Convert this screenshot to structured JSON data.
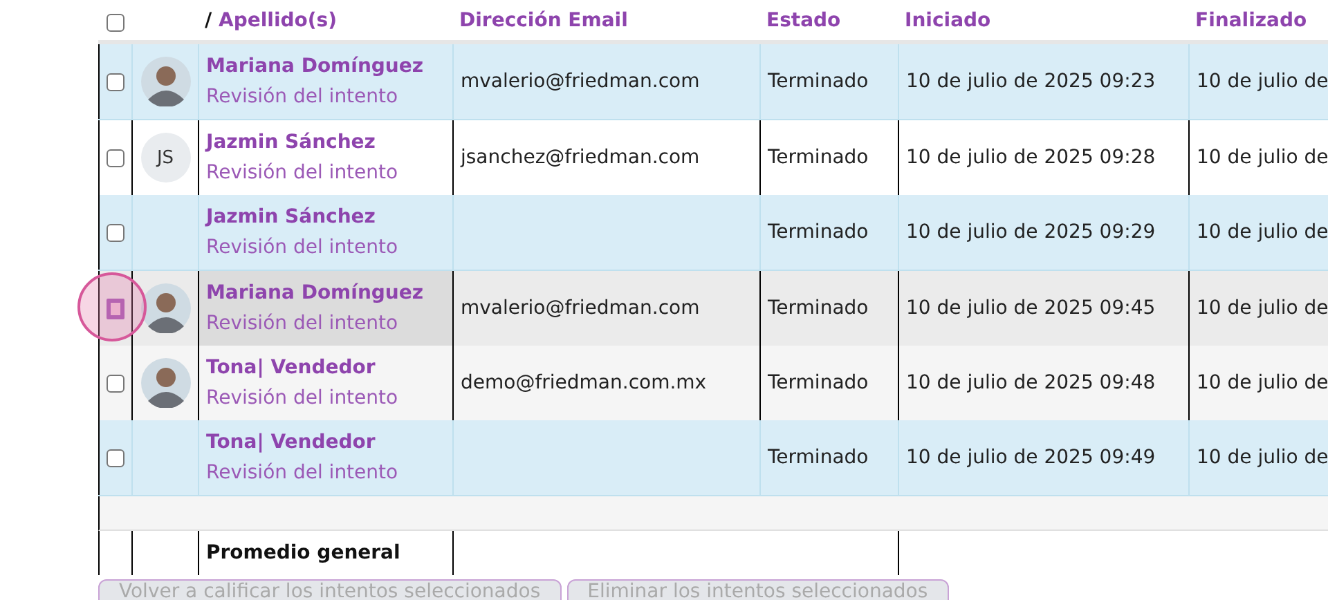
{
  "table": {
    "header": {
      "checked": false,
      "name_separator": "/",
      "name_column": "Apellido(s)",
      "columns": [
        "Dirección Email",
        "Estado",
        "Iniciado",
        "Finalizado"
      ]
    },
    "rows": [
      {
        "kind": "info",
        "checked": false,
        "focused": false,
        "avatar": {
          "kind": "photo"
        },
        "name": "Mariana Domínguez",
        "link": "Revisión del intento",
        "email": "mvalerio@friedman.com",
        "status": "Terminado",
        "started": "10 de julio de 2025 09:23",
        "finished": "10 de julio de"
      },
      {
        "kind": "plain",
        "checked": false,
        "focused": false,
        "avatar": {
          "kind": "initials",
          "text": "JS"
        },
        "name": "Jazmin Sánchez",
        "link": "Revisión del intento",
        "email": "jsanchez@friedman.com",
        "status": "Terminado",
        "started": "10 de julio de 2025 09:28",
        "finished": "10 de julio de"
      },
      {
        "kind": "info",
        "checked": false,
        "focused": false,
        "avatar": {
          "kind": "none"
        },
        "name": "Jazmin Sánchez",
        "link": "Revisión del intento",
        "email": "",
        "status": "Terminado",
        "started": "10 de julio de 2025 09:29",
        "finished": "10 de julio de"
      },
      {
        "kind": "hover",
        "checked": false,
        "focused": true,
        "avatar": {
          "kind": "photo"
        },
        "name": "Mariana Domínguez",
        "link": "Revisión del intento",
        "email": "mvalerio@friedman.com",
        "status": "Terminado",
        "started": "10 de julio de 2025 09:45",
        "finished": "10 de julio de"
      },
      {
        "kind": "striped",
        "checked": false,
        "focused": false,
        "avatar": {
          "kind": "photo"
        },
        "name": "Tona| Vendedor",
        "link": "Revisión del intento",
        "email": "demo@friedman.com.mx",
        "status": "Terminado",
        "started": "10 de julio de 2025 09:48",
        "finished": "10 de julio de"
      },
      {
        "kind": "info",
        "checked": false,
        "focused": false,
        "avatar": {
          "kind": "none"
        },
        "name": "Tona| Vendedor",
        "link": "Revisión del intento",
        "email": "",
        "status": "Terminado",
        "started": "10 de julio de 2025 09:49",
        "finished": "10 de julio de"
      }
    ],
    "summary": {
      "label": "Promedio general"
    }
  },
  "buttons": [
    {
      "label": "Volver a calificar los intentos seleccionados",
      "disabled": true
    },
    {
      "label": "Eliminar los intentos seleccionados",
      "disabled": true
    }
  ]
}
